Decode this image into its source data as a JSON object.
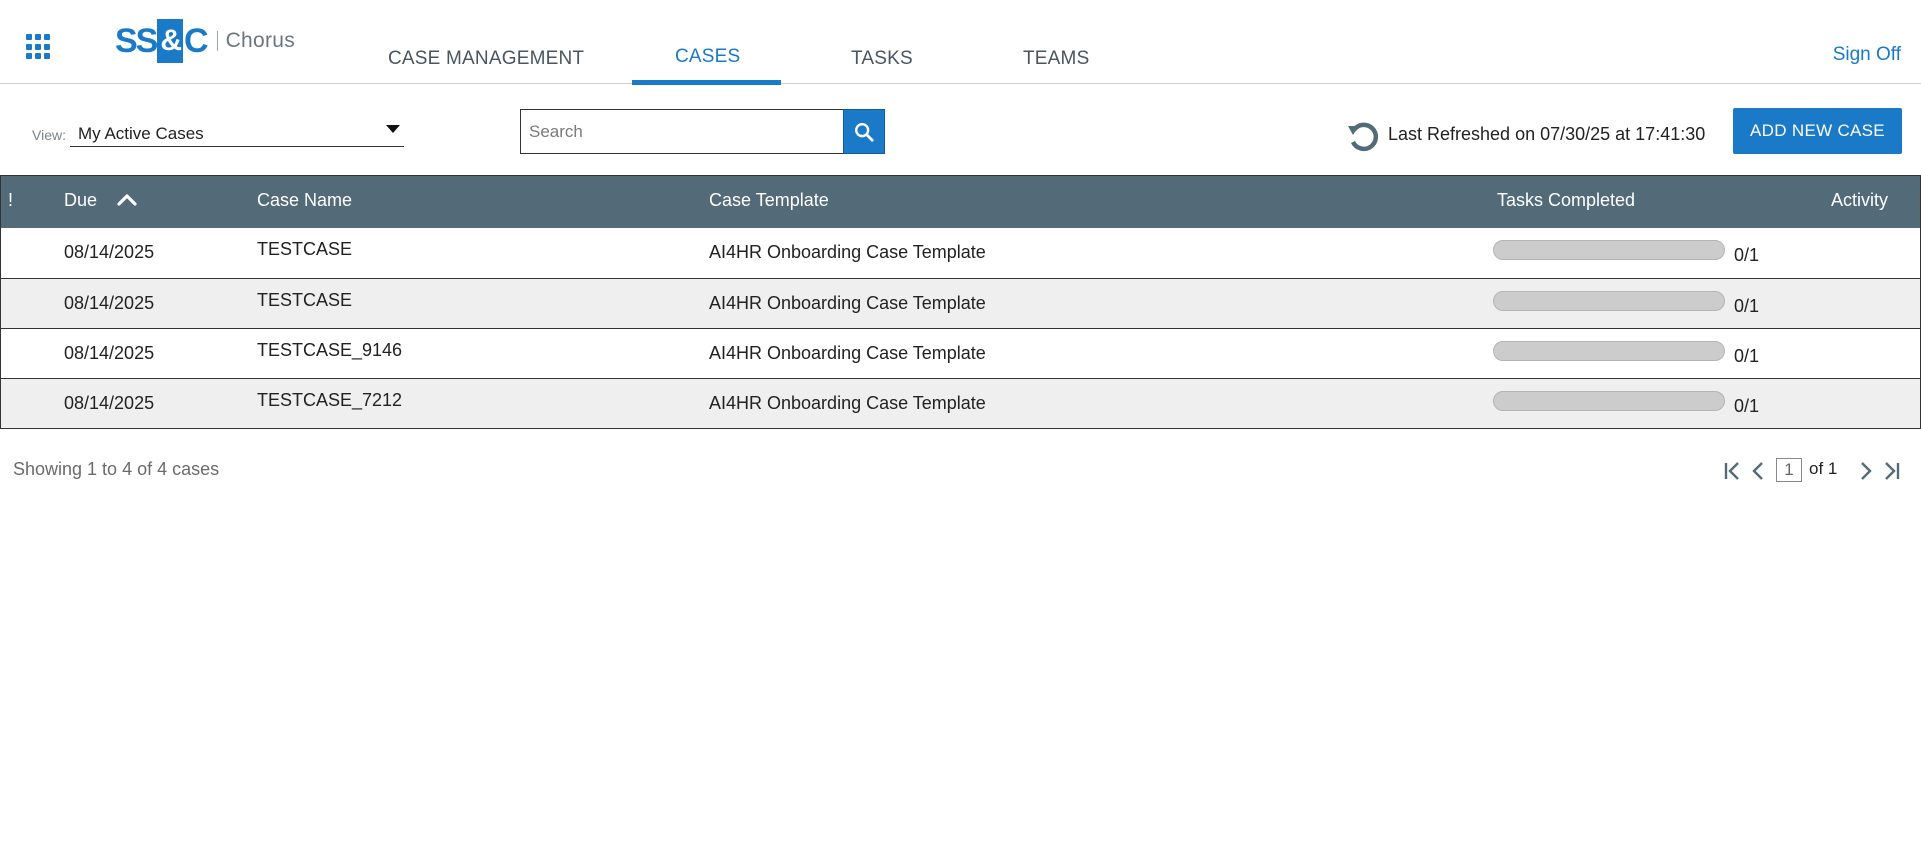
{
  "header": {
    "logo_mark_left": "SS",
    "logo_mark_amp": "&",
    "logo_mark_right": "C",
    "logo_text": "Chorus",
    "tabs": [
      {
        "label": "CASE MANAGEMENT",
        "active": false
      },
      {
        "label": "CASES",
        "active": true
      },
      {
        "label": "TASKS",
        "active": false
      },
      {
        "label": "TEAMS",
        "active": false
      }
    ],
    "sign_off": "Sign Off"
  },
  "toolbar": {
    "view_label": "View:",
    "view_value": "My Active Cases",
    "search_placeholder": "Search",
    "search_value": "",
    "last_refreshed": "Last Refreshed on 07/30/25 at 17:41:30",
    "add_button": "ADD NEW CASE"
  },
  "table": {
    "columns": {
      "priority": "!",
      "due": "Due",
      "case_name": "Case Name",
      "case_template": "Case Template",
      "tasks_completed": "Tasks Completed",
      "activity": "Activity"
    },
    "sort": {
      "column": "due",
      "direction": "ascending"
    },
    "rows": [
      {
        "due": "08/14/2025",
        "case_name": "TESTCASE",
        "case_template": "AI4HR Onboarding Case Template",
        "tasks_completed": "0/1",
        "progress": 0
      },
      {
        "due": "08/14/2025",
        "case_name": "TESTCASE",
        "case_template": "AI4HR Onboarding Case Template",
        "tasks_completed": "0/1",
        "progress": 0
      },
      {
        "due": "08/14/2025",
        "case_name": "TESTCASE_9146",
        "case_template": "AI4HR Onboarding Case Template",
        "tasks_completed": "0/1",
        "progress": 0
      },
      {
        "due": "08/14/2025",
        "case_name": "TESTCASE_7212",
        "case_template": "AI4HR Onboarding Case Template",
        "tasks_completed": "0/1",
        "progress": 0
      }
    ]
  },
  "footer": {
    "showing": "Showing 1 to 4 of 4 cases",
    "current_page": "1",
    "of_pages": "of 1"
  },
  "colors": {
    "brand_blue": "#1a7ac7",
    "header_row": "#536b78",
    "alt_row": "#efefef",
    "progress_track": "#cccccc"
  }
}
